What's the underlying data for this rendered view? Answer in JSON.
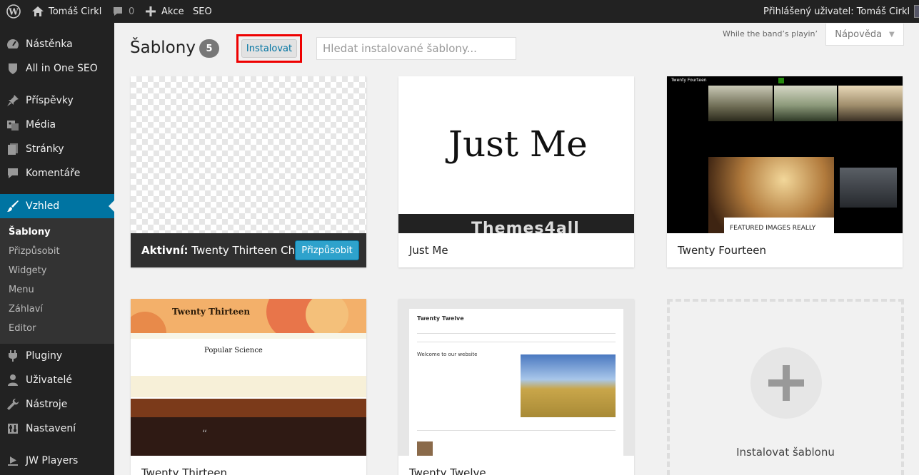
{
  "admin_bar": {
    "site_name": "Tomáš Cirkl",
    "comments_count": "0",
    "new_label": "Akce",
    "seo_label": "SEO",
    "greeting": "Přihlášený uživatel: Tomáš Cirkl"
  },
  "sidebar": {
    "items": [
      {
        "label": "Nástěnka",
        "icon": "dashboard-icon"
      },
      {
        "label": "All in One SEO",
        "icon": "shield-icon"
      },
      {
        "label": "Příspěvky",
        "icon": "pin-icon"
      },
      {
        "label": "Média",
        "icon": "media-icon"
      },
      {
        "label": "Stránky",
        "icon": "pages-icon"
      },
      {
        "label": "Komentáře",
        "icon": "comment-icon"
      },
      {
        "label": "Vzhled",
        "icon": "brush-icon"
      },
      {
        "label": "Pluginy",
        "icon": "plugin-icon"
      },
      {
        "label": "Uživatelé",
        "icon": "user-icon"
      },
      {
        "label": "Nástroje",
        "icon": "wrench-icon"
      },
      {
        "label": "Nastavení",
        "icon": "settings-icon"
      },
      {
        "label": "JW Players",
        "icon": "play-icon"
      }
    ],
    "submenu": [
      "Šablony",
      "Přizpůsobit",
      "Widgety",
      "Menu",
      "Záhlaví",
      "Editor"
    ]
  },
  "page": {
    "title": "Šablony",
    "count": "5",
    "install_button": "Instalovat",
    "search_placeholder": "Hledat instalované šablony...",
    "hello_dolly": "While the band’s playin’",
    "help_label": "Nápověda"
  },
  "themes": [
    {
      "name": "Twenty Thirteen Child",
      "active_prefix": "Aktivní:",
      "customize_label": "Přizpůsobit"
    },
    {
      "name": "Just Me",
      "preview_title": "Just Me",
      "preview_banner": "Themes4all"
    },
    {
      "name": "Twenty Fourteen",
      "preview_title": "Twenty Fourteen",
      "preview_caption": "FEATURED IMAGES REALLY"
    },
    {
      "name": "Twenty Thirteen",
      "preview_title": "Twenty Thirteen",
      "preview_post": "Popular Science"
    },
    {
      "name": "Twenty Twelve",
      "preview_title": "Twenty Twelve",
      "preview_heading": "Welcome to our website"
    }
  ],
  "add_theme": {
    "label": "Instalovat šablonu"
  },
  "colors": {
    "accent": "#0074a2",
    "button": "#2ea2cc",
    "highlight": "#ee0000",
    "sidebar": "#222222"
  }
}
